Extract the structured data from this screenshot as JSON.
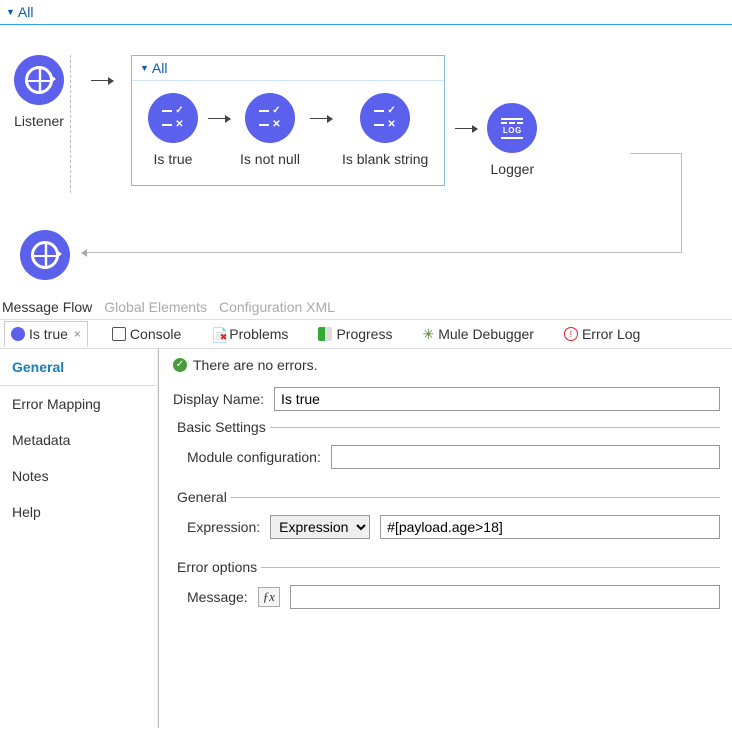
{
  "flow": {
    "outer_label": "All",
    "inner_label": "All",
    "listener": "Listener",
    "nodes": [
      "Is true",
      "Is not null",
      "Is blank string"
    ],
    "logger": "Logger"
  },
  "editor_tabs": {
    "message_flow": "Message Flow",
    "global_elements": "Global Elements",
    "config_xml": "Configuration XML"
  },
  "props_tabs": {
    "istrue": "Is true",
    "console": "Console",
    "problems": "Problems",
    "progress": "Progress",
    "debugger": "Mule Debugger",
    "error_log": "Error Log"
  },
  "sidebar": {
    "items": [
      "General",
      "Error Mapping",
      "Metadata",
      "Notes",
      "Help"
    ]
  },
  "form": {
    "status": "There are no errors.",
    "display_name_label": "Display Name:",
    "display_name_value": "Is true",
    "basic_settings_legend": "Basic Settings",
    "module_config_label": "Module configuration:",
    "module_config_value": "",
    "general_legend": "General",
    "expression_label": "Expression:",
    "expression_mode": "Expression",
    "expression_value": "#[payload.age>18]",
    "error_options_legend": "Error options",
    "message_label": "Message:",
    "message_value": ""
  }
}
